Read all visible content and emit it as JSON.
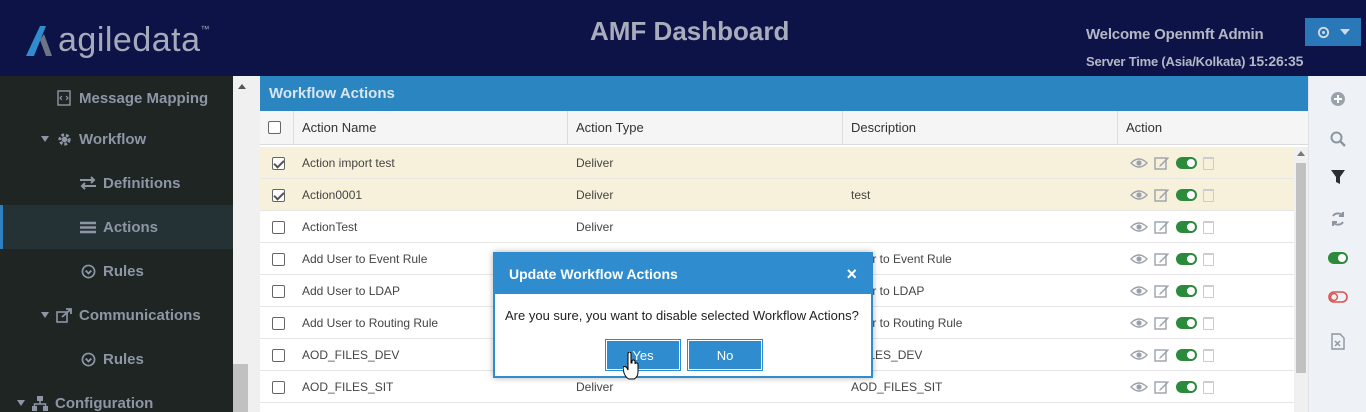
{
  "header": {
    "logo_text": "agiledata",
    "logo_tm": "™",
    "title": "AMF Dashboard",
    "welcome": "Welcome Openmft Admin",
    "server_time_label": "Server Time (Asia/Kolkata)",
    "server_time_value": "15:26:35"
  },
  "sidebar": {
    "items": [
      {
        "label": "Message Mapping",
        "icon": "document-code-icon"
      },
      {
        "label": "Workflow",
        "icon": "gear-icon"
      },
      {
        "label": "Definitions",
        "icon": "arrows-swap-icon"
      },
      {
        "label": "Actions",
        "icon": "list-icon"
      },
      {
        "label": "Rules",
        "icon": "circle-arrow-icon"
      },
      {
        "label": "Communications",
        "icon": "share-icon"
      },
      {
        "label": "Rules",
        "icon": "circle-arrow-icon"
      },
      {
        "label": "Configuration",
        "icon": "sitemap-icon"
      }
    ]
  },
  "panel": {
    "title": "Workflow Actions",
    "columns": [
      "Action Name",
      "Action Type",
      "Description",
      "Action"
    ]
  },
  "rows": [
    {
      "name": "Action import test",
      "type": "Deliver",
      "description": "",
      "checked": true
    },
    {
      "name": "Action0001",
      "type": "Deliver",
      "description": "test",
      "checked": true
    },
    {
      "name": "ActionTest",
      "type": "Deliver",
      "description": "",
      "checked": false
    },
    {
      "name": "Add User to Event Rule",
      "type": "",
      "description": "User to Event Rule",
      "checked": false
    },
    {
      "name": "Add User to LDAP",
      "type": "",
      "description": "User to LDAP",
      "checked": false
    },
    {
      "name": "Add User to Routing Rule",
      "type": "",
      "description": "User to Routing Rule",
      "checked": false
    },
    {
      "name": "AOD_FILES_DEV",
      "type": "",
      "description": "_FILES_DEV",
      "checked": false
    },
    {
      "name": "AOD_FILES_SIT",
      "type": "Deliver",
      "description": "AOD_FILES_SIT",
      "checked": false
    }
  ],
  "modal": {
    "title": "Update Workflow Actions",
    "close": "×",
    "message": "Are you sure, you want to disable selected Workflow Actions?",
    "yes": "Yes",
    "no": "No"
  },
  "colors": {
    "header_bg": "#0d1346",
    "accent": "#2e8ccf",
    "sidebar_bg": "#1e2523",
    "selected_row": "#f7f1dc",
    "toggle_on": "#2c8a3c",
    "toggle_off": "#d9534f"
  }
}
